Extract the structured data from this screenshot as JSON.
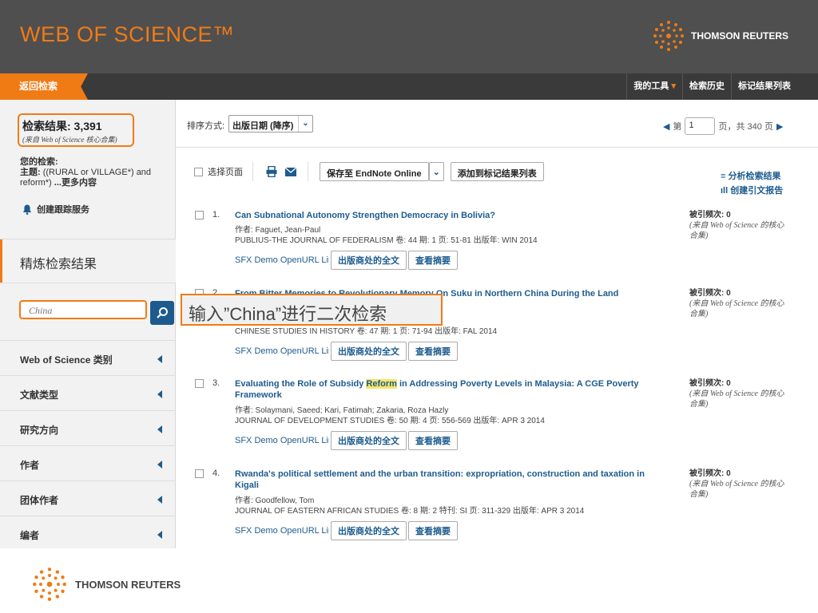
{
  "header": {
    "logo": "WEB OF SCIENCE™",
    "brand": "THOMSON REUTERS"
  },
  "nav": {
    "back": "返回检索",
    "my_tools": "我的工具",
    "search_history": "检索历史",
    "marked_list": "标记结果列表"
  },
  "sidebar": {
    "results_label": "检索结果: 3,391",
    "results_source": "(来自 Web of Science 核心合集)",
    "your_search_label": "您的检索:",
    "topic_label": "主题:",
    "query": "((RURAL or VILLAGE*) and reform*)",
    "more": "...更多内容",
    "create_alert": "创建跟踪服务",
    "refine_title": "精炼检索结果",
    "search_value": "China",
    "facets": [
      "Web of Science 类别",
      "文献类型",
      "研究方向",
      "作者",
      "团体作者",
      "编者"
    ]
  },
  "callout": "输入”China”进行二次检索",
  "sort": {
    "label": "排序方式:",
    "value": "出版日期 (降序)"
  },
  "pager": {
    "prefix": "第",
    "page": "1",
    "suffix": "页，共  340  页"
  },
  "toolbar": {
    "select_page": "选择页面",
    "save_endnote": "保存至 EndNote Online",
    "add_marked": "添加到标记结果列表"
  },
  "right_links": {
    "analyze": "分析检索结果",
    "citation_report": "创建引文报告"
  },
  "records": [
    {
      "num": "1.",
      "title": "Can Subnational Autonomy Strengthen Democracy in Bolivia?",
      "title_pre": "",
      "highlight": "",
      "title_post": "",
      "authors": "作者: Faguet, Jean-Paul",
      "journal": "PUBLIUS-THE JOURNAL OF FEDERALISM  卷: 44   期: 1   页: 51-81   出版年: WIN 2014",
      "cited": "被引频次: 0",
      "cited_src": "(来自 Web of Science 的核心合集)"
    },
    {
      "num": "2.",
      "title": "From Bitter Memories to Revolutionary Memory On Suku in Northern China During the Land",
      "title_pre": "",
      "highlight": "",
      "title_post": "",
      "authors": "",
      "journal": "CHINESE STUDIES IN HISTORY  卷: 47   期: 1   页: 71-94   出版年: FAL 2014",
      "cited": "被引频次: 0",
      "cited_src": "(来自 Web of Science 的核心合集)"
    },
    {
      "num": "3.",
      "title": "",
      "title_pre": "Evaluating the Role of Subsidy ",
      "highlight": "Reform",
      "title_post": " in Addressing Poverty Levels in Malaysia: A CGE Poverty Framework",
      "authors": "作者: Solaymani, Saeed; Kari, Fatimah; Zakaria, Roza Hazly",
      "journal": "JOURNAL OF DEVELOPMENT STUDIES  卷: 50   期: 4   页: 556-569   出版年: APR 3 2014",
      "cited": "被引频次: 0",
      "cited_src": "(来自 Web of Science 的核心合集)"
    },
    {
      "num": "4.",
      "title": "Rwanda's political settlement and the urban transition: expropriation, construction and taxation in Kigali",
      "title_pre": "",
      "highlight": "",
      "title_post": "",
      "authors": "作者: Goodfellow, Tom",
      "journal": "JOURNAL OF EASTERN AFRICAN STUDIES  卷: 8   期: 2   特刊: SI   页: 311-329   出版年: APR 3 2014",
      "cited": "被引频次: 0",
      "cited_src": "(来自 Web of Science 的核心合集)"
    }
  ],
  "record_links": {
    "sfx": "SFX Demo OpenURL Link",
    "full_text": "出版商处的全文",
    "abstract": "查看摘要"
  },
  "footer": {
    "brand": "THOMSON REUTERS"
  },
  "colors": {
    "accent": "#f07b15",
    "link": "#1d5b8e",
    "header": "#4f4f4f"
  }
}
